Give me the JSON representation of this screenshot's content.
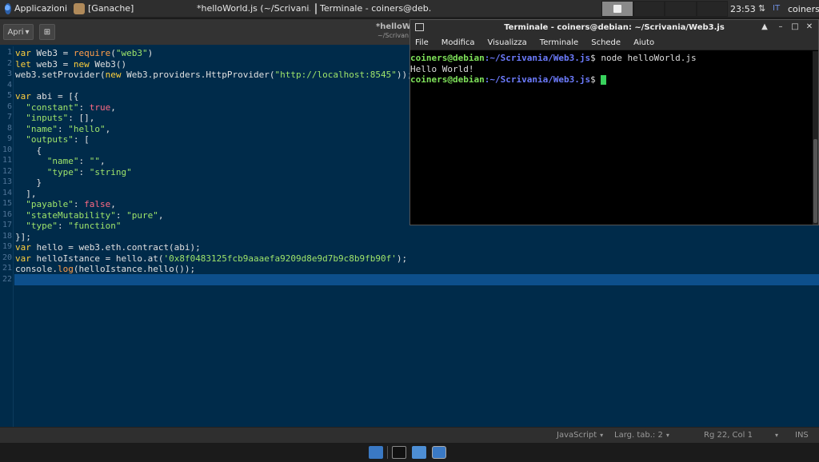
{
  "panel": {
    "apps_label": "Applicazioni",
    "ganache_label": "[Ganache]",
    "task_editor": "*helloWorld.js (~/Scrivani...",
    "task_terminal": "Terminale - coiners@deb...",
    "clock": "23:53",
    "lang": "IT",
    "user": "coiners"
  },
  "editor": {
    "open_label": "Apri",
    "title": "*helloW",
    "subtitle": "~/Scrivan",
    "lines": [
      "var Web3 = require(\"web3\")",
      "let web3 = new Web3()",
      "web3.setProvider(new Web3.providers.HttpProvider(\"http://localhost:8545\"));",
      "",
      "var abi = [{",
      "  \"constant\": true,",
      "  \"inputs\": [],",
      "  \"name\": \"hello\",",
      "  \"outputs\": [",
      "    {",
      "      \"name\": \"\",",
      "      \"type\": \"string\"",
      "    }",
      "  ],",
      "  \"payable\": false,",
      "  \"stateMutability\": \"pure\",",
      "  \"type\": \"function\"",
      "}];",
      "var hello = web3.eth.contract(abi);",
      "var helloIstance = hello.at('0x8f0483125fcb9aaaefa9209d8e9d7b9c8b9fb90f');",
      "console.log(helloIstance.hello());",
      ""
    ],
    "current_line": 22
  },
  "status": {
    "language": "JavaScript",
    "tab_width": "Larg. tab.: 2",
    "position": "Rg 22, Col 1",
    "mode": "INS"
  },
  "terminal": {
    "title": "Terminale - coiners@debian: ~/Scrivania/Web3.js",
    "menu": [
      "File",
      "Modifica",
      "Visualizza",
      "Terminale",
      "Schede",
      "Aiuto"
    ],
    "prompt_user": "coiners@debian",
    "prompt_path": ":~/Scrivania/Web3.js",
    "prompt_symbol": "$",
    "command": " node helloWorld.js",
    "output": "Hello World!"
  }
}
